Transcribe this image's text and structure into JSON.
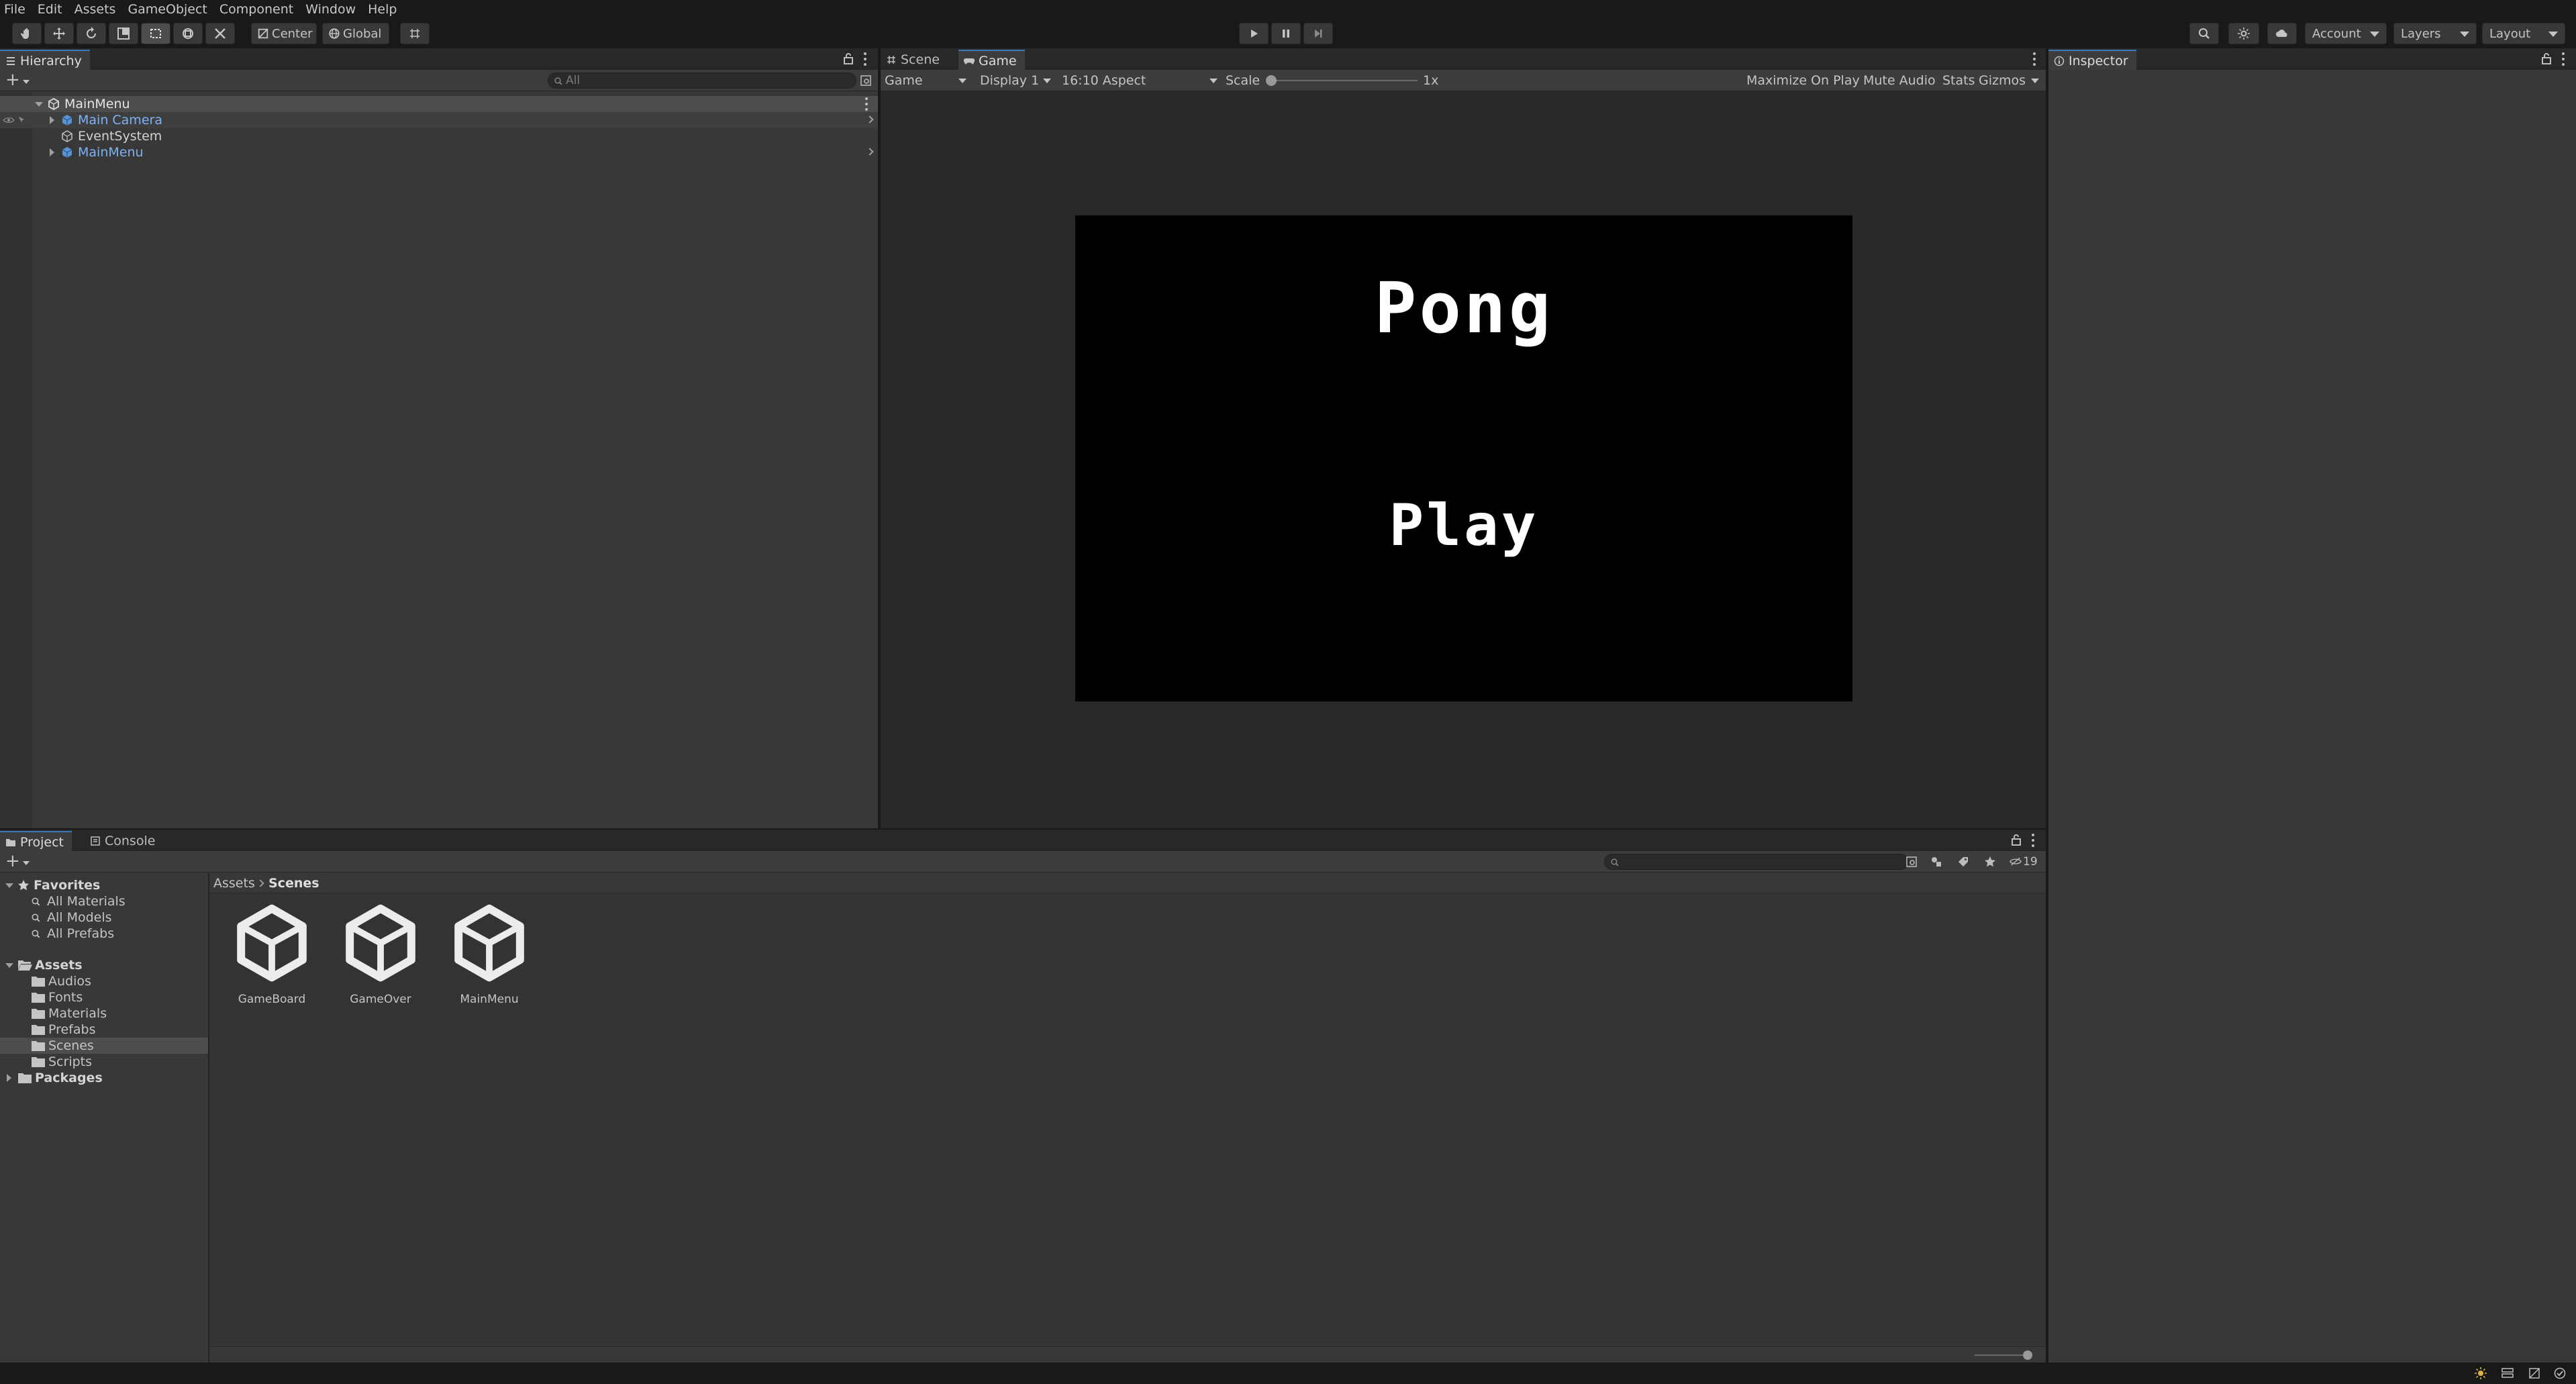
{
  "menu": [
    "File",
    "Edit",
    "Assets",
    "GameObject",
    "Component",
    "Window",
    "Help"
  ],
  "toolbar": {
    "pivot_label": "Center",
    "space_label": "Global",
    "account_label": "Account",
    "layers_label": "Layers",
    "layout_label": "Layout"
  },
  "hierarchy": {
    "tab": "Hierarchy",
    "search_placeholder": "All",
    "scene": "MainMenu",
    "items": [
      "Main Camera",
      "EventSystem",
      "MainMenu"
    ]
  },
  "views": {
    "tabs": [
      "Scene",
      "Game"
    ],
    "game_display_mode": "Game",
    "display": "Display 1",
    "aspect": "16:10 Aspect",
    "scale_label": "Scale",
    "scale_value": "1x",
    "maximize": "Maximize On Play",
    "mute": "Mute Audio",
    "stats": "Stats",
    "gizmos": "Gizmos"
  },
  "game": {
    "title": "Pong",
    "play": "Play"
  },
  "inspector": {
    "tab": "Inspector"
  },
  "project": {
    "tabs": [
      "Project",
      "Console"
    ],
    "hidden_count": "19",
    "favorites": "Favorites",
    "favorite_items": [
      "All Materials",
      "All Models",
      "All Prefabs"
    ],
    "assets_root": "Assets",
    "asset_folders": [
      "Audios",
      "Fonts",
      "Materials",
      "Prefabs",
      "Scenes",
      "Scripts"
    ],
    "packages": "Packages",
    "breadcrumb": [
      "Assets",
      "Scenes"
    ],
    "scene_assets": [
      "GameBoard",
      "GameOver",
      "MainMenu"
    ]
  },
  "colors": {
    "accent": "#3a79bb",
    "prefab_blue": "#7cb3f2",
    "selection": "#4d4d4d"
  }
}
